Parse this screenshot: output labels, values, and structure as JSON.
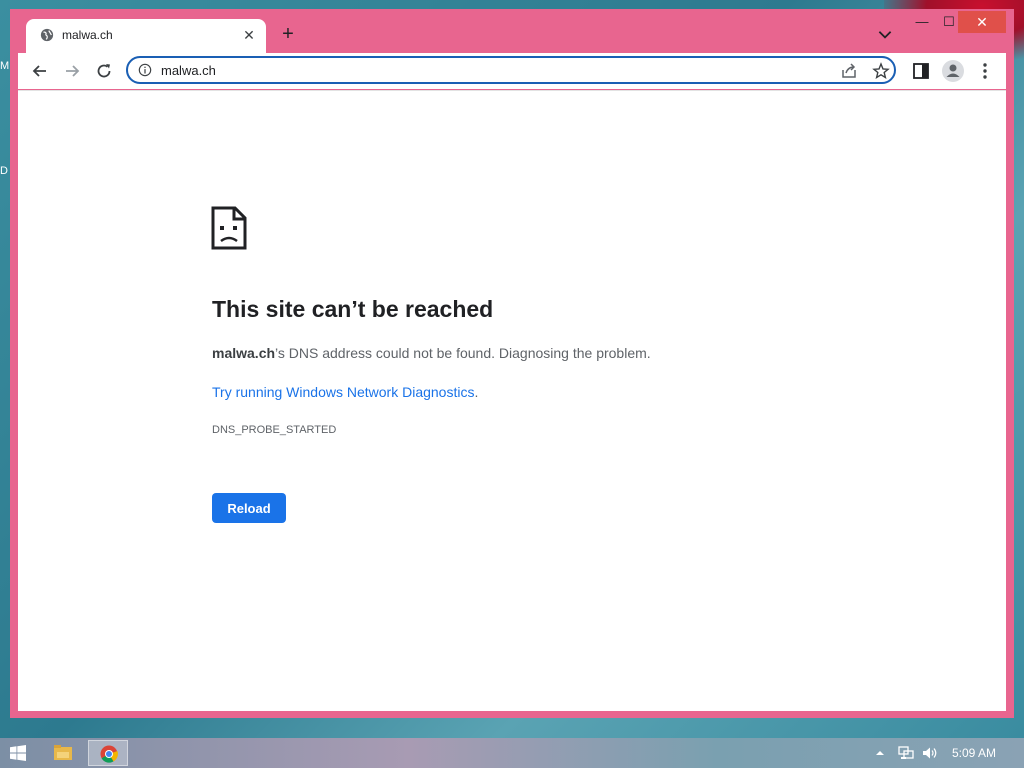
{
  "tab": {
    "title": "malwa.ch",
    "close_glyph": "✕"
  },
  "new_tab_glyph": "+",
  "window_controls": {
    "minimize": "—",
    "maximize": "☐",
    "close": "✕"
  },
  "omnibox": {
    "url": "malwa.ch"
  },
  "error": {
    "title": "This site can’t be reached",
    "desc_bold": "malwa.ch",
    "desc_rest": "’s DNS address could not be found. Diagnosing the problem.",
    "link_text": "Try running Windows Network Diagnostics",
    "link_suffix": ".",
    "code": "DNS_PROBE_STARTED",
    "reload_label": "Reload"
  },
  "desktop_letters": [
    "M",
    "D"
  ],
  "taskbar": {
    "clock": "5:09 AM"
  },
  "icons": [
    "globe-icon",
    "close-icon",
    "plus-icon",
    "chevron-down-icon",
    "back-icon",
    "forward-icon",
    "reload-icon",
    "info-icon",
    "share-icon",
    "star-icon",
    "side-panel-icon",
    "profile-icon",
    "menu-icon",
    "sad-page-icon",
    "windows-start-icon",
    "file-explorer-icon",
    "chrome-icon",
    "tray-arrow-icon",
    "network-icon",
    "volume-icon"
  ],
  "colors": {
    "frame": "#e8658f",
    "link": "#1a73e8",
    "button": "#1a73e8",
    "close": "#e0504a"
  }
}
